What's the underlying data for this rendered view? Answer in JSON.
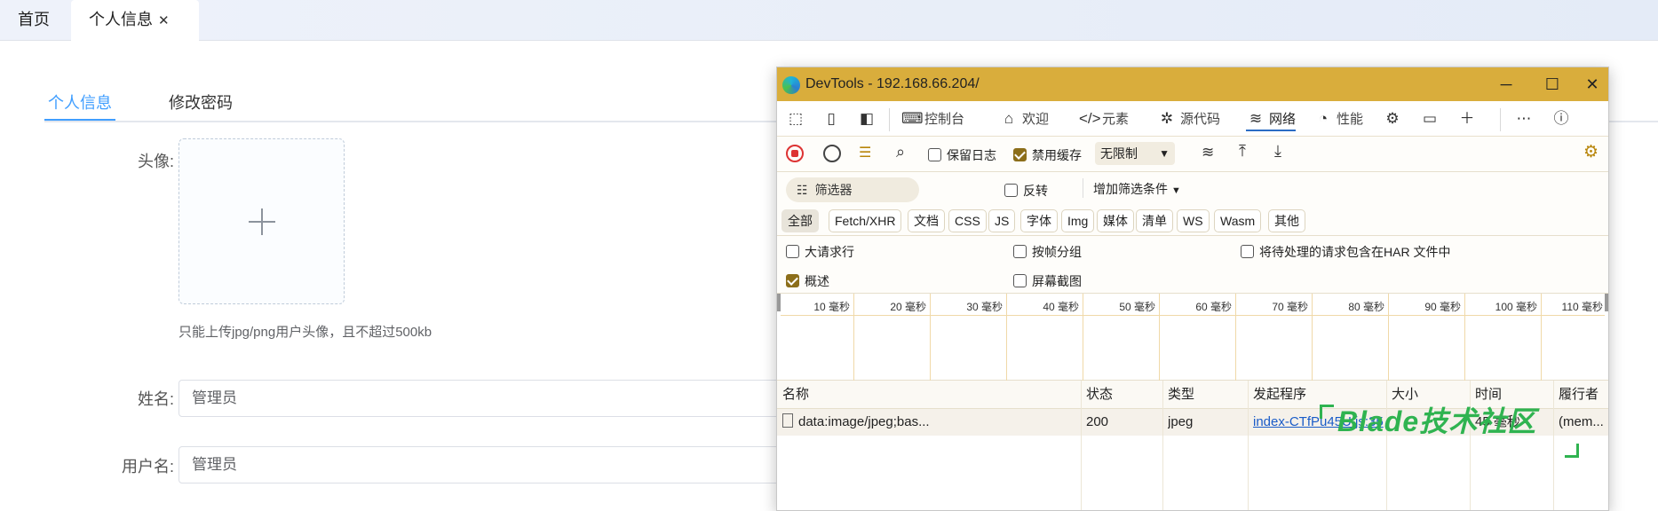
{
  "app_tabs": {
    "home": "首页",
    "profile": "个人信息",
    "close": "✕"
  },
  "page_tabs": {
    "info": "个人信息",
    "password": "修改密码"
  },
  "form": {
    "avatar_label": "头像:",
    "avatar_tip": "只能上传jpg/png用户头像，且不超过500kb",
    "name_label": "姓名:",
    "name_value": "管理员",
    "username_label": "用户名:",
    "username_value": "管理员"
  },
  "devtools": {
    "title": "DevTools - 192.168.66.204/",
    "tabs": [
      {
        "label": "控制台",
        "icon": "console-icon"
      },
      {
        "label": "欢迎",
        "icon": "home-icon"
      },
      {
        "label": "元素",
        "icon": "code-icon"
      },
      {
        "label": "源代码",
        "icon": "bug-icon"
      },
      {
        "label": "网络",
        "icon": "wifi-icon"
      },
      {
        "label": "性能",
        "icon": "gauge-icon"
      }
    ],
    "network_toolbar": {
      "preserve_log": "保留日志",
      "disable_cache": "禁用缓存",
      "throttle": "无限制"
    },
    "filter": {
      "placeholder": "筛选器",
      "invert": "反转",
      "more_filters": "增加筛选条件"
    },
    "type_chips": [
      "全部",
      "Fetch/XHR",
      "文档",
      "CSS",
      "JS",
      "字体",
      "Img",
      "媒体",
      "清单",
      "WS",
      "Wasm",
      "其他"
    ],
    "options": {
      "big_rows": "大请求行",
      "group_by_frame": "按帧分组",
      "har": "将待处理的请求包含在HAR 文件中",
      "overview": "概述",
      "screenshots": "屏幕截图"
    },
    "timeline_ticks": [
      "10 毫秒",
      "20 毫秒",
      "30 毫秒",
      "40 毫秒",
      "50 毫秒",
      "60 毫秒",
      "70 毫秒",
      "80 毫秒",
      "90 毫秒",
      "100 毫秒",
      "110 毫秒"
    ],
    "columns": [
      "名称",
      "状态",
      "类型",
      "发起程序",
      "大小",
      "时间",
      "履行者"
    ],
    "rows": [
      {
        "name": "data:image/jpeg;bas...",
        "status": "200",
        "type": "jpeg",
        "initiator": "index-CTfPu45U.js:35",
        "size": "",
        "time": "45 毫秒",
        "fulfilled": "(mem..."
      }
    ]
  },
  "watermark": "Blade技术社区",
  "colors": {
    "accent": "#409eff",
    "devtools_title": "#d9ad3c",
    "watermark": "#2fb350"
  }
}
